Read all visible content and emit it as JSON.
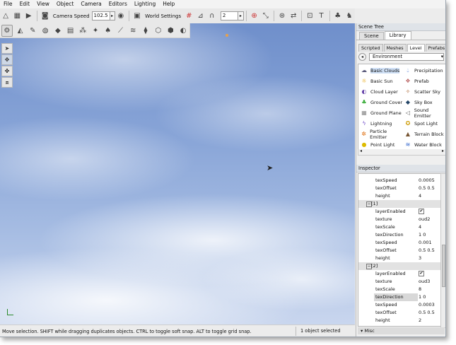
{
  "menu": [
    "File",
    "Edit",
    "View",
    "Object",
    "Camera",
    "Editors",
    "Lighting",
    "Help"
  ],
  "toolbar": {
    "camera_speed_label": "Camera Speed",
    "camera_speed_value": "102.5",
    "world_settings_label": "World Settings",
    "snap_value": "2"
  },
  "status": {
    "hint": "Move selection.  SHIFT while dragging duplicates objects.  CTRL to toggle soft snap.  ALT to toggle grid snap.",
    "selection": "1 object selected"
  },
  "scene_tree": {
    "title": "Scene Tree",
    "tabs": [
      "Scene",
      "Library"
    ],
    "active_tab": "Library",
    "subtabs": [
      "Scripted",
      "Meshes",
      "Level",
      "Prefabs"
    ],
    "active_subtab": "Level",
    "category": "Environment",
    "items": [
      {
        "label": "Basic Clouds",
        "icon": "cloud-icon"
      },
      {
        "label": "Precipitation",
        "icon": "raindrop-icon"
      },
      {
        "label": "Basic Sun",
        "icon": "sun-icon"
      },
      {
        "label": "Prefab",
        "icon": "prefab-icon"
      },
      {
        "label": "Cloud Layer",
        "icon": "cloud-layer-icon"
      },
      {
        "label": "Scatter Sky",
        "icon": "scatter-sky-icon"
      },
      {
        "label": "Ground Cover",
        "icon": "ground-cover-icon"
      },
      {
        "label": "Sky Box",
        "icon": "sky-box-icon"
      },
      {
        "label": "Ground Plane",
        "icon": "ground-plane-icon"
      },
      {
        "label": "Sound Emitter",
        "icon": "speaker-icon"
      },
      {
        "label": "Lightning",
        "icon": "lightning-icon"
      },
      {
        "label": "Spot Light",
        "icon": "spot-light-icon"
      },
      {
        "label": "Particle Emitter",
        "icon": "particle-icon"
      },
      {
        "label": "Terrain Block",
        "icon": "terrain-icon"
      },
      {
        "label": "Point Light",
        "icon": "point-light-icon"
      },
      {
        "label": "Water Block",
        "icon": "water-icon"
      }
    ]
  },
  "inspector": {
    "title": "Inspector",
    "rows": [
      {
        "key": "texSpeed",
        "value": "0.0005"
      },
      {
        "key": "texOffset",
        "value": "0.5 0.5"
      },
      {
        "key": "height",
        "value": "4"
      },
      {
        "key": "[1]",
        "value": "",
        "group": true
      },
      {
        "key": "layerEnabled",
        "value": "✔",
        "check": true
      },
      {
        "key": "texture",
        "value": "oud2"
      },
      {
        "key": "texScale",
        "value": "4"
      },
      {
        "key": "texDirection",
        "value": "1 0"
      },
      {
        "key": "texSpeed",
        "value": "0.001"
      },
      {
        "key": "texOffset",
        "value": "0.5 0.5"
      },
      {
        "key": "height",
        "value": "3"
      },
      {
        "key": "[2]",
        "value": "",
        "group": true
      },
      {
        "key": "layerEnabled",
        "value": "✔",
        "check": true
      },
      {
        "key": "texture",
        "value": "oud3"
      },
      {
        "key": "texScale",
        "value": "8"
      },
      {
        "key": "texDirection",
        "value": "1 0",
        "highlight": true
      },
      {
        "key": "texSpeed",
        "value": "0.0003"
      },
      {
        "key": "texOffset",
        "value": "0.5 0.5"
      },
      {
        "key": "height",
        "value": "2"
      }
    ],
    "misc_label": "Misc"
  }
}
